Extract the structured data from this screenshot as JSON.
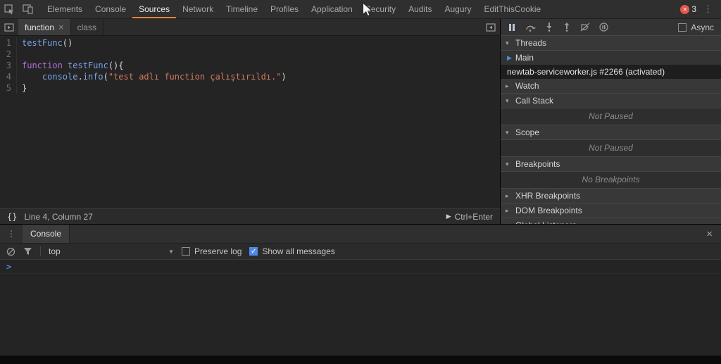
{
  "colors": {
    "accent": "#e8853d",
    "error": "#e2574c",
    "blue": "#4e8ae5",
    "code-ident": "#7aa2e8",
    "code-func": "#7aa2e8",
    "code-keyword": "#b06edb",
    "code-string": "#d2795e"
  },
  "icons": {
    "chevron_down": "▾",
    "chevron_right": "▸",
    "close": "×",
    "overflow": "⋮",
    "badge_x": "✕",
    "play": "▶",
    "exec_arrow": "▶",
    "dropdown": "▼",
    "check": "✓",
    "braces": "{}",
    "prompt": ">"
  },
  "topbar": {
    "tabs": [
      {
        "label": "Elements"
      },
      {
        "label": "Console"
      },
      {
        "label": "Sources",
        "selected": true
      },
      {
        "label": "Network"
      },
      {
        "label": "Timeline"
      },
      {
        "label": "Profiles"
      },
      {
        "label": "Application"
      },
      {
        "label": "Security"
      },
      {
        "label": "Audits"
      },
      {
        "label": "Augury"
      },
      {
        "label": "EditThisCookie"
      }
    ],
    "error_count": "3"
  },
  "sources": {
    "editor_tabs": [
      {
        "label": "function"
      },
      {
        "label": "class"
      }
    ],
    "code": {
      "lines": [
        {
          "num": "1",
          "tokens": [
            {
              "t": "testFunc",
              "c": "ident"
            },
            {
              "t": "()",
              "c": "plain"
            }
          ]
        },
        {
          "num": "2",
          "tokens": []
        },
        {
          "num": "3",
          "tokens": [
            {
              "t": "function",
              "c": "keyword"
            },
            {
              "t": " ",
              "c": "plain"
            },
            {
              "t": "testFunc",
              "c": "func"
            },
            {
              "t": "(){",
              "c": "plain"
            }
          ]
        },
        {
          "num": "4",
          "tokens": [
            {
              "t": "    ",
              "c": "plain"
            },
            {
              "t": "console",
              "c": "ident"
            },
            {
              "t": ".",
              "c": "plain"
            },
            {
              "t": "info",
              "c": "func"
            },
            {
              "t": "(",
              "c": "plain"
            },
            {
              "t": "\"test adlı function çalıştırıldı.\"",
              "c": "string"
            },
            {
              "t": ")",
              "c": "plain"
            }
          ]
        },
        {
          "num": "5",
          "tokens": [
            {
              "t": "}",
              "c": "plain"
            }
          ]
        }
      ]
    },
    "status": {
      "position": "Line 4, Column 27",
      "shortcut": "Ctrl+Enter"
    }
  },
  "debugger": {
    "async_label": "Async",
    "threads": {
      "label": "Threads",
      "items": [
        {
          "name": "Main",
          "active": true
        },
        {
          "name": "newtab-serviceworker.js #2266 (activated)",
          "selected": true
        }
      ]
    },
    "watch": {
      "label": "Watch"
    },
    "call_stack": {
      "label": "Call Stack",
      "placeholder": "Not Paused"
    },
    "scope": {
      "label": "Scope",
      "placeholder": "Not Paused"
    },
    "breakpoints": {
      "label": "Breakpoints",
      "placeholder": "No Breakpoints"
    },
    "xhr_breakpoints": {
      "label": "XHR Breakpoints"
    },
    "dom_breakpoints": {
      "label": "DOM Breakpoints"
    },
    "partial_section": {
      "label": "Global Listeners"
    }
  },
  "console": {
    "tab_label": "Console",
    "context": "top",
    "preserve_log_label": "Preserve log",
    "show_all_label": "Show all messages"
  }
}
